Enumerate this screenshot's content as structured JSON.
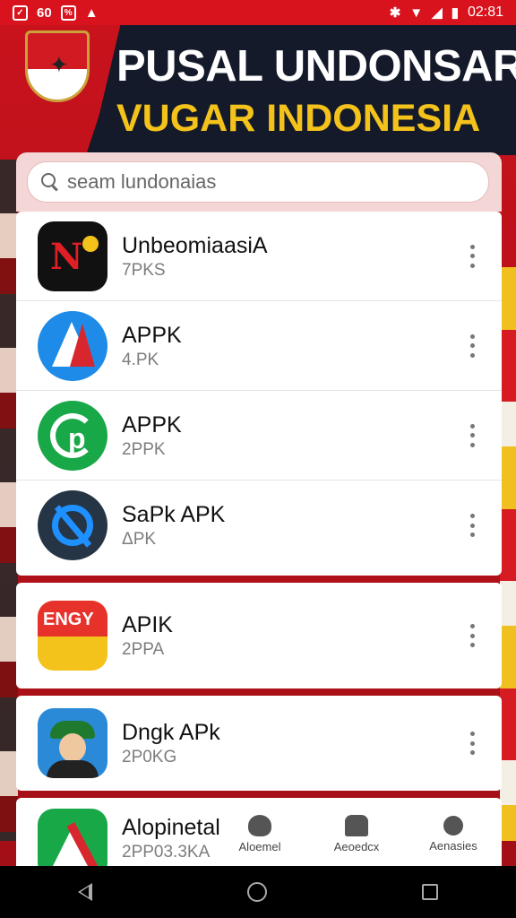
{
  "status_bar": {
    "left_icons": [
      "notification-icon",
      "sim-icon",
      "app-notification-icon",
      "photo-icon"
    ],
    "left_text": "60",
    "time": "02:81"
  },
  "banner": {
    "title": "PUSAL UNDONSAR",
    "subtitle": "VUGAR INDONESIA",
    "accent": "#f3c21b",
    "brand": "#d8131d"
  },
  "search": {
    "placeholder": "Search",
    "value": "seam lundonaias"
  },
  "apps": [
    {
      "name": "UnbeomiaasiA",
      "sub": "7PKS"
    },
    {
      "name": "APPK",
      "sub": "4.PK"
    },
    {
      "name": "APPK",
      "sub": "2PPK"
    },
    {
      "name": "SaPk APK",
      "sub": "ΔPK"
    },
    {
      "name": "APIK",
      "sub": "2PPA"
    },
    {
      "name": "Dngk APk",
      "sub": "2P0KG"
    },
    {
      "name": "Alopinetal",
      "sub": "2PP03.3KA"
    }
  ],
  "bottom_tabs": [
    {
      "label": "Aloemel",
      "icon": "flower-icon"
    },
    {
      "label": "Aeoedcx",
      "icon": "basket-icon"
    },
    {
      "label": "Aenasies",
      "icon": "profile-icon"
    }
  ],
  "nav": {
    "buttons": [
      "back-icon",
      "home-icon",
      "recents-icon"
    ]
  }
}
